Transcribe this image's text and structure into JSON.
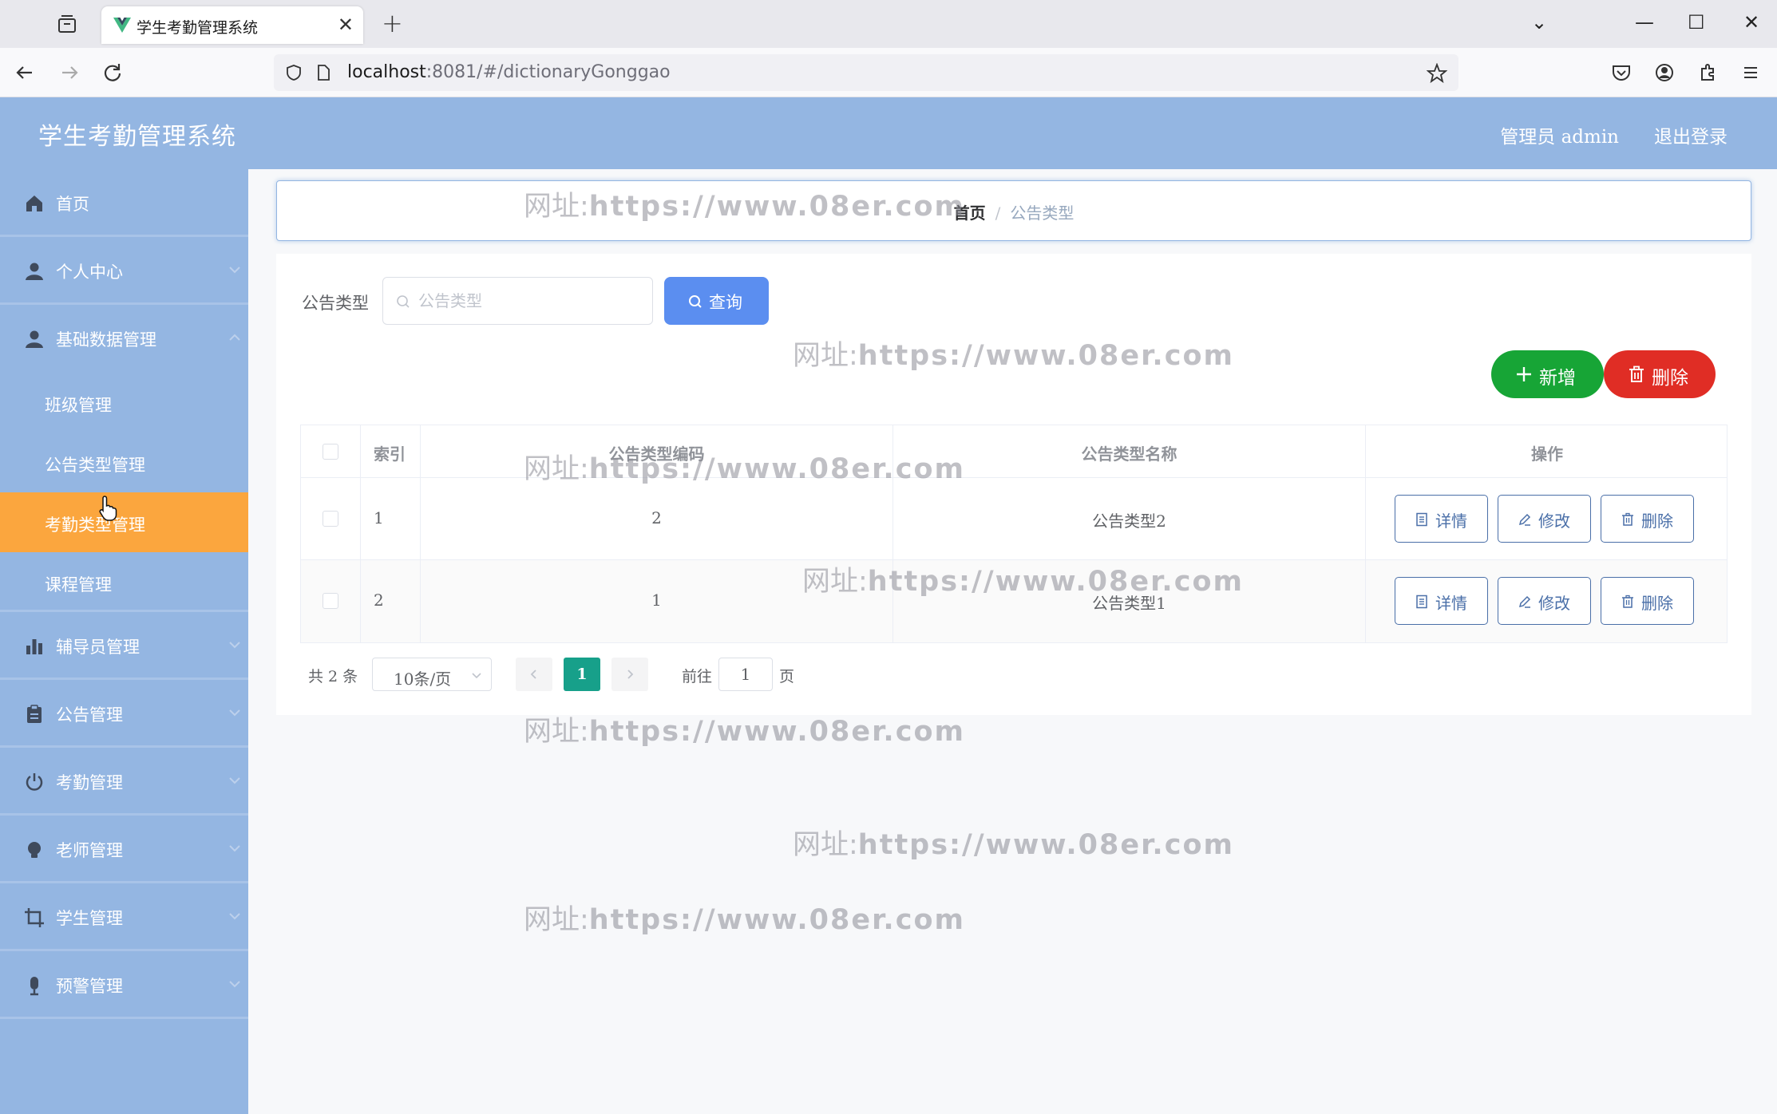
{
  "browser": {
    "tab_title": "学生考勤管理系统",
    "url_host": "localhost",
    "url_rest": ":8081/#/dictionaryGonggao"
  },
  "header": {
    "title": "学生考勤管理系统",
    "user": "管理员 admin",
    "logout": "退出登录"
  },
  "sidebar": {
    "items": [
      {
        "label": "首页"
      },
      {
        "label": "个人中心"
      },
      {
        "label": "基础数据管理"
      },
      {
        "label": "辅导员管理"
      },
      {
        "label": "公告管理"
      },
      {
        "label": "考勤管理"
      },
      {
        "label": "老师管理"
      },
      {
        "label": "学生管理"
      },
      {
        "label": "预警管理"
      }
    ],
    "sub_items": [
      {
        "label": "班级管理"
      },
      {
        "label": "公告类型管理"
      },
      {
        "label": "考勤类型管理"
      },
      {
        "label": "课程管理"
      }
    ],
    "active_sub": "考勤类型管理"
  },
  "breadcrumb": {
    "home": "首页",
    "separator": "/",
    "current": "公告类型"
  },
  "search": {
    "label": "公告类型",
    "placeholder": "公告类型",
    "value": "",
    "button": "查询"
  },
  "actions": {
    "add": "新增",
    "delete": "删除"
  },
  "table": {
    "headers": [
      "索引",
      "公告类型编码",
      "公告类型名称",
      "操作"
    ],
    "rows": [
      {
        "index": "1",
        "code": "2",
        "name": "公告类型2"
      },
      {
        "index": "2",
        "code": "1",
        "name": "公告类型1"
      }
    ],
    "row_actions": {
      "detail": "详情",
      "edit": "修改",
      "delete": "删除"
    }
  },
  "pagination": {
    "total": "共 2 条",
    "page_size": "10条/页",
    "current_page": "1",
    "goto_label": "前往",
    "goto_value": "1",
    "page_suffix": "页"
  },
  "watermark": {
    "prefix": "网址:",
    "url": "https://www.08er.com"
  },
  "colors": {
    "header": "#94b6e2",
    "active_menu": "#fba63e",
    "query_button": "#5b8ef0",
    "add_button": "#17a536",
    "delete_button": "#e02d25",
    "current_page": "#17a08a"
  }
}
